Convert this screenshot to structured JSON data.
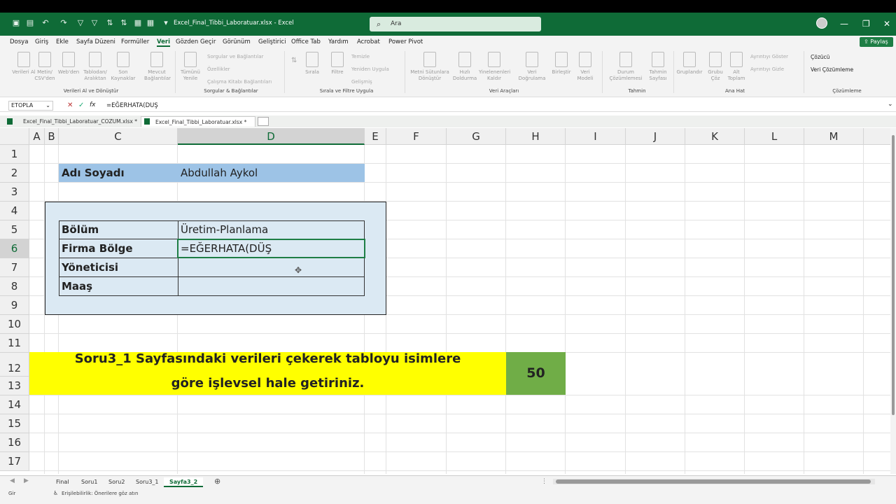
{
  "window": {
    "title": "Excel_Final_Tibbi_Laboratuar.xlsx - Excel",
    "search_placeholder": "Ara"
  },
  "menu": [
    "Dosya",
    "Giriş",
    "Ekle",
    "Sayfa Düzeni",
    "Formüller",
    "Veri",
    "Gözden Geçir",
    "Görünüm",
    "Geliştirici",
    "Office Tab",
    "Yardım",
    "Acrobat",
    "Power Pivot"
  ],
  "active_menu": "Veri",
  "share_label": "Paylaş",
  "ribbon": {
    "g1": {
      "b1": "Verileri Al",
      "b2": "Metin/ CSV'den",
      "b3": "Web'den",
      "b4": "Tablodan/ Aralıktan",
      "b5": "Son Kaynaklar",
      "b6": "Mevcut Bağlantılar",
      "label": "Verileri Al ve Dönüştür"
    },
    "g2": {
      "b1": "Tümünü Yenile",
      "s1": "Sorgular ve Bağlantılar",
      "s2": "Özellikler",
      "s3": "Çalışma Kitabı Bağlantıları",
      "label": "Sorgular & Bağlantılar"
    },
    "g3": {
      "b1": "Sırala",
      "b2": "Filtre",
      "s1": "Temizle",
      "s2": "Yeniden Uygula",
      "s3": "Gelişmiş",
      "label": "Sırala ve Filtre Uygula"
    },
    "g4": {
      "b1": "Metni Sütunlara Dönüştür",
      "b2": "Hızlı Doldurma",
      "b3": "Yinelenenleri Kaldır",
      "b4": "Veri Doğrulama",
      "b5": "Birleştir",
      "b6": "Veri Modeli",
      "label": "Veri Araçları"
    },
    "g5": {
      "b1": "Durum Çözümlemesi",
      "b2": "Tahmin Sayfası",
      "label": "Tahmin"
    },
    "g6": {
      "b1": "Gruplandır",
      "b2": "Grubu Çöz",
      "b3": "Alt Toplam",
      "s1": "Ayrıntıyı Göster",
      "s2": "Ayrıntıyı Gizle",
      "label": "Ana Hat"
    },
    "g7": {
      "s1": "Çözücü",
      "s2": "Veri Çözümleme",
      "label": "Çözümleme"
    }
  },
  "formula_bar": {
    "name_box": "ETOPLA",
    "cancel": "✕",
    "confirm": "✓",
    "fx": "fx",
    "formula": "=EĞERHATA(DUŞ"
  },
  "workbook_tabs": [
    "Excel_Final_Tibbi_Laboratuar_COZUM.xlsx *",
    "Excel_Final_Tibbi_Laboratuar.xlsx *"
  ],
  "columns": [
    "A",
    "B",
    "C",
    "D",
    "E",
    "F",
    "G",
    "H",
    "I",
    "J",
    "K",
    "L",
    "M"
  ],
  "rows": [
    "1",
    "2",
    "3",
    "4",
    "5",
    "6",
    "7",
    "8",
    "9",
    "10",
    "11",
    "12",
    "13",
    "14",
    "15",
    "16",
    "17"
  ],
  "cells": {
    "name_label": "Adı Soyadı",
    "name_value": "Abdullah Aykol",
    "r5_label": "Bölüm",
    "r5_value": "Üretim-Planlama",
    "r6_label": "Firma Bölge",
    "r6_value": "=EĞERHATA(DÜŞ",
    "r7_label": "Yöneticisi",
    "r8_label": "Maaş"
  },
  "banner": {
    "line1": "Soru3_1 Sayfasındaki verileri çekerek tabloyu isimlere",
    "line2": "göre işlevsel hale getiriniz.",
    "score": "50"
  },
  "sheets": [
    "Final",
    "Soru1",
    "Soru2",
    "Soru3_1",
    "Sayfa3_2"
  ],
  "active_sheet": "Sayfa3_2",
  "status": {
    "mode": "Gir",
    "accessibility": "Erişilebilirlik: Önerilere göz atın"
  },
  "colors": {
    "title_green": "#0f6b37",
    "name_fill": "#9dc3e6",
    "table_fill": "#dbe9f3",
    "banner_yellow": "#ffff00",
    "score_green": "#70ad47"
  }
}
